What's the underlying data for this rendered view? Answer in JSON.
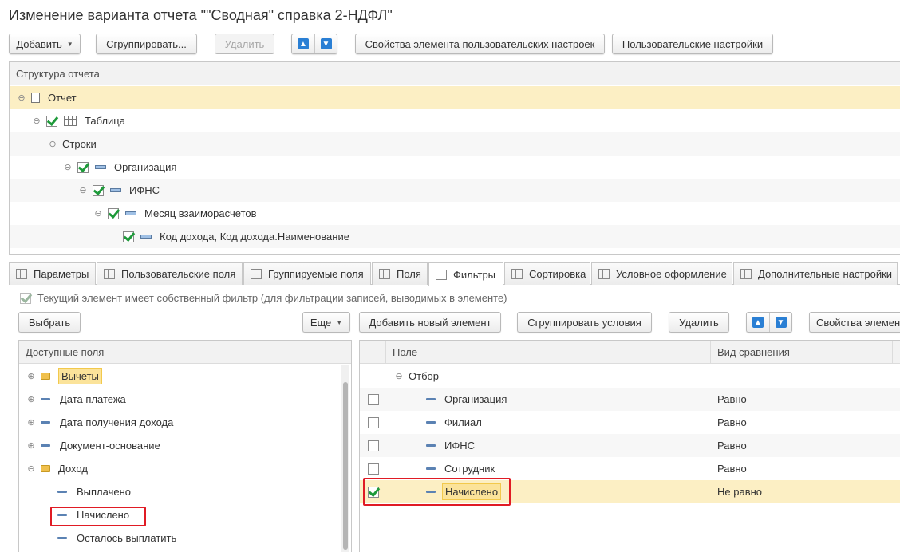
{
  "window": {
    "title": "Изменение варианта отчета \"\"Сводная\" справка 2-НДФЛ\""
  },
  "toolbar": {
    "add": "Добавить",
    "group": "Сгруппировать...",
    "delete": "Удалить",
    "element_props": "Свойства элемента пользовательских настроек",
    "user_settings": "Пользовательские настройки"
  },
  "structure": {
    "header": "Структура отчета",
    "rows": [
      {
        "label": "Отчет"
      },
      {
        "label": "Таблица"
      },
      {
        "label": "Строки"
      },
      {
        "label": "Организация"
      },
      {
        "label": "ИФНС"
      },
      {
        "label": "Месяц взаиморасчетов"
      },
      {
        "label": "Код дохода, Код дохода.Наименование"
      }
    ]
  },
  "tabs": [
    {
      "label": "Параметры"
    },
    {
      "label": "Пользовательские поля"
    },
    {
      "label": "Группируемые поля"
    },
    {
      "label": "Поля"
    },
    {
      "label": "Фильтры"
    },
    {
      "label": "Сортировка"
    },
    {
      "label": "Условное оформление"
    },
    {
      "label": "Дополнительные настройки"
    }
  ],
  "active_tab": "Фильтры",
  "filter": {
    "own_filter_note": "Текущий элемент имеет собственный фильтр (для фильтрации записей, выводимых в элементе)",
    "select": "Выбрать",
    "more": "Еще",
    "add_new": "Добавить новый элемент",
    "group_conditions": "Сгруппировать условия",
    "delete": "Удалить",
    "props": "Свойства элемен"
  },
  "available_fields": {
    "header": "Доступные поля",
    "items": [
      {
        "label": "Вычеты"
      },
      {
        "label": "Дата платежа"
      },
      {
        "label": "Дата получения дохода"
      },
      {
        "label": "Документ-основание"
      },
      {
        "label": "Доход"
      },
      {
        "label": "Выплачено"
      },
      {
        "label": "Начислено"
      },
      {
        "label": "Осталось выплатить"
      }
    ]
  },
  "filter_table": {
    "col_field": "Поле",
    "col_comparison": "Вид сравнения",
    "root": "Отбор",
    "rows": [
      {
        "field": "Организация",
        "comparison": "Равно",
        "checked": false
      },
      {
        "field": "Филиал",
        "comparison": "Равно",
        "checked": false
      },
      {
        "field": "ИФНС",
        "comparison": "Равно",
        "checked": false
      },
      {
        "field": "Сотрудник",
        "comparison": "Равно",
        "checked": false
      },
      {
        "field": "Начислено",
        "comparison": "Не равно",
        "checked": true
      }
    ]
  },
  "colors": {
    "selection": "#fcefc4",
    "highlight_box": "#e01b24",
    "checkmark": "#1e9a3a",
    "arrow_button": "#2a7fd4"
  }
}
